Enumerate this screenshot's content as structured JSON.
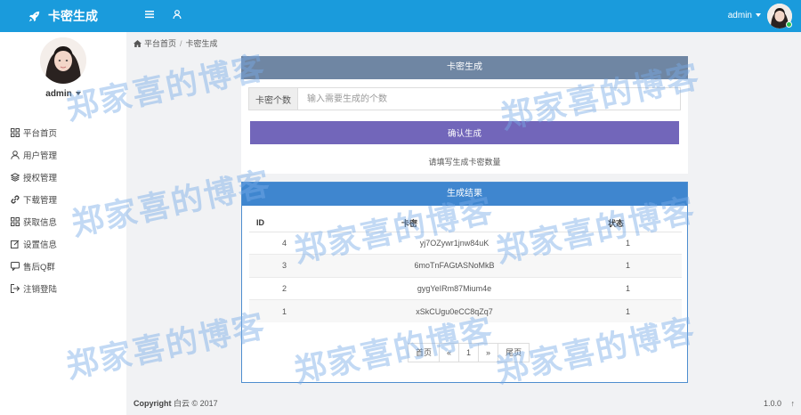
{
  "brand": {
    "title": "卡密生成"
  },
  "topbar": {
    "user": "admin"
  },
  "sidebar": {
    "user": "admin",
    "items": [
      {
        "label": "平台首页",
        "icon": "grid-icon"
      },
      {
        "label": "用户管理",
        "icon": "user-icon"
      },
      {
        "label": "授权管理",
        "icon": "layers-icon"
      },
      {
        "label": "下载管理",
        "icon": "link-icon"
      },
      {
        "label": "获取信息",
        "icon": "grid-icon"
      },
      {
        "label": "设置信息",
        "icon": "edit-icon"
      },
      {
        "label": "售后Q群",
        "icon": "chat-icon"
      },
      {
        "label": "注销登陆",
        "icon": "logout-icon"
      }
    ]
  },
  "breadcrumb": {
    "home": "平台首页",
    "current": "卡密生成"
  },
  "generate": {
    "title": "卡密生成",
    "addon": "卡密个数",
    "placeholder": "输入需要生成的个数",
    "button": "确认生成",
    "hint": "请填写生成卡密数量"
  },
  "result": {
    "title": "生成结果",
    "columns": [
      "ID",
      "卡密",
      "状态"
    ],
    "rows": [
      {
        "id": "4",
        "key": "yj7OZywr1jnw84uK",
        "status": "1"
      },
      {
        "id": "3",
        "key": "6moTnFAGtASNoMkB",
        "status": "1"
      },
      {
        "id": "2",
        "key": "gygYeIRm87Mium4e",
        "status": "1"
      },
      {
        "id": "1",
        "key": "xSkCUgu0eCC8qZq7",
        "status": "1"
      }
    ],
    "pager": [
      "首页",
      "«",
      "1",
      "»",
      "尾页"
    ]
  },
  "footer": {
    "copyright": "Copyright",
    "text": "白云 © 2017",
    "version": "1.0.0",
    "arrow": "↑"
  },
  "watermark": "郑家喜的博客"
}
